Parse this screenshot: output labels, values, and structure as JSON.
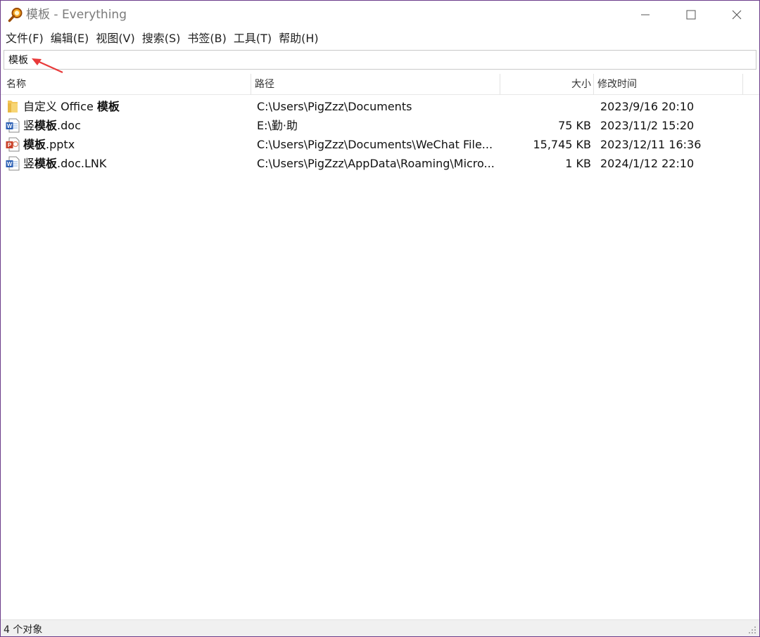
{
  "window": {
    "title": "模板 - Everything",
    "icon": "everything-magnifier-icon"
  },
  "menu": [
    "文件(F)",
    "编辑(E)",
    "视图(V)",
    "搜索(S)",
    "书签(B)",
    "工具(T)",
    "帮助(H)"
  ],
  "search": {
    "value": "模板"
  },
  "columns": {
    "name": "名称",
    "path": "路径",
    "size": "大小",
    "date": "修改时间"
  },
  "rows": [
    {
      "icon": "folder-icon",
      "name_prefix": "自定义 Office ",
      "name_match": "模板",
      "name_suffix": "",
      "path": "C:\\Users\\PigZzz\\Documents",
      "size": "",
      "date": "2023/9/16 20:10"
    },
    {
      "icon": "word-document-icon",
      "name_prefix": "竖",
      "name_match": "模板",
      "name_suffix": ".doc",
      "path": "E:\\勤·助",
      "size": "75 KB",
      "date": "2023/11/2 15:20"
    },
    {
      "icon": "powerpoint-file-icon",
      "name_prefix": "",
      "name_match": "模板",
      "name_suffix": ".pptx",
      "path": "C:\\Users\\PigZzz\\Documents\\WeChat File...",
      "size": "15,745 KB",
      "date": "2023/12/11 16:36"
    },
    {
      "icon": "word-document-icon",
      "name_prefix": "竖",
      "name_match": "模板",
      "name_suffix": ".doc.LNK",
      "path": "C:\\Users\\PigZzz\\AppData\\Roaming\\Micro...",
      "size": "1 KB",
      "date": "2024/1/12 22:10"
    }
  ],
  "status": {
    "text": "4 个对象"
  },
  "colors": {
    "border": "#6b3c8a",
    "annotation_arrow": "#e83a3a"
  }
}
